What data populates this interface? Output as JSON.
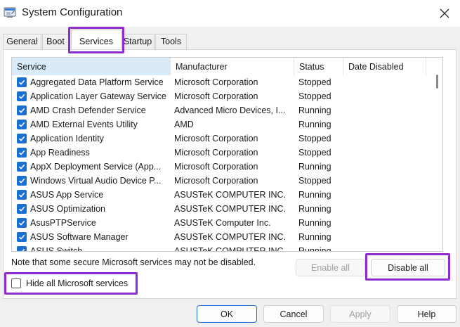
{
  "window": {
    "title": "System Configuration"
  },
  "tabs": [
    {
      "label": "General"
    },
    {
      "label": "Boot"
    },
    {
      "label": "Services",
      "active": true
    },
    {
      "label": "Startup"
    },
    {
      "label": "Tools"
    }
  ],
  "table": {
    "columns": [
      "Service",
      "Manufacturer",
      "Status",
      "Date Disabled"
    ],
    "rows": [
      {
        "service": "Aggregated Data Platform Service",
        "manufacturer": "Microsoft Corporation",
        "status": "Stopped",
        "date_disabled": ""
      },
      {
        "service": "Application Layer Gateway Service",
        "manufacturer": "Microsoft Corporation",
        "status": "Stopped",
        "date_disabled": ""
      },
      {
        "service": "AMD Crash Defender Service",
        "manufacturer": "Advanced Micro Devices, I...",
        "status": "Running",
        "date_disabled": ""
      },
      {
        "service": "AMD External Events Utility",
        "manufacturer": "AMD",
        "status": "Running",
        "date_disabled": ""
      },
      {
        "service": "Application Identity",
        "manufacturer": "Microsoft Corporation",
        "status": "Stopped",
        "date_disabled": ""
      },
      {
        "service": "App Readiness",
        "manufacturer": "Microsoft Corporation",
        "status": "Stopped",
        "date_disabled": ""
      },
      {
        "service": "AppX Deployment Service (App...",
        "manufacturer": "Microsoft Corporation",
        "status": "Running",
        "date_disabled": ""
      },
      {
        "service": "Windows Virtual Audio Device P...",
        "manufacturer": "Microsoft Corporation",
        "status": "Stopped",
        "date_disabled": ""
      },
      {
        "service": "ASUS App Service",
        "manufacturer": "ASUSTeK COMPUTER INC.",
        "status": "Running",
        "date_disabled": ""
      },
      {
        "service": "ASUS Optimization",
        "manufacturer": "ASUSTeK COMPUTER INC.",
        "status": "Running",
        "date_disabled": ""
      },
      {
        "service": "AsusPTPService",
        "manufacturer": "ASUSTeK Computer Inc.",
        "status": "Running",
        "date_disabled": ""
      },
      {
        "service": "ASUS Software Manager",
        "manufacturer": "ASUSTeK COMPUTER INC.",
        "status": "Running",
        "date_disabled": ""
      },
      {
        "service": "ASUS Switch",
        "manufacturer": "ASUSTeK COMPUTER INC.",
        "status": "Running",
        "date_disabled": ""
      }
    ]
  },
  "note": "Note that some secure Microsoft services may not be disabled.",
  "buttons": {
    "enable_all": "Enable all",
    "disable_all": "Disable all",
    "ok": "OK",
    "cancel": "Cancel",
    "apply": "Apply",
    "help": "Help"
  },
  "hide_ms": {
    "label": "Hide all Microsoft services",
    "checked": false
  },
  "colors": {
    "highlight": "#8f2cd0",
    "accent": "#1a6fd1",
    "sorted_header": "#d9ebf9"
  },
  "icons": {
    "app": "msconfig-icon",
    "close": "close-icon",
    "check": "checkmark-icon"
  }
}
